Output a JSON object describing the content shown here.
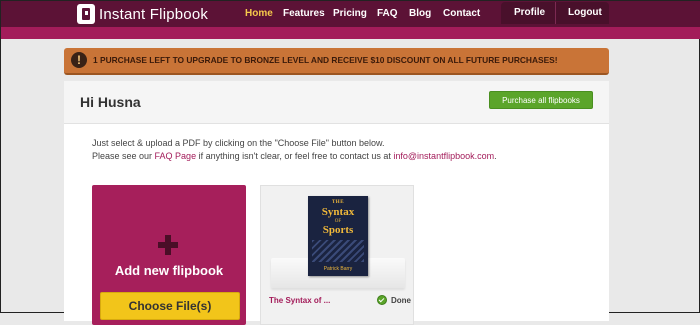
{
  "app": {
    "logo_text": "Instant Flipbook",
    "nav": [
      "Home",
      "Features",
      "Pricing",
      "FAQ",
      "Blog",
      "Contact"
    ],
    "right_nav": [
      "Profile",
      "Logout"
    ],
    "active_tab": "Home",
    "accent_color": "#a31c5a",
    "nav_bg_color": "#5c1236",
    "active_nav_color": "#f6c94b"
  },
  "banner": {
    "icon": "exclamation-icon",
    "text": "1 PURCHASE LEFT TO UPGRADE TO BRONZE LEVEL AND RECEIVE $10 DISCOUNT ON ALL FUTURE PURCHASES!",
    "color": "#c97437"
  },
  "main": {
    "greeting": "Hi Husna",
    "purchase_button": "Purchase all flipbooks",
    "instruction_line1": "Just select & upload a PDF by clicking on the \"Choose File\" button below.",
    "instruction_line2_prefix": "Please see our ",
    "faq_link": "FAQ Page",
    "instruction_line2_middle": " if anything isn't clear, or feel free to contact us at ",
    "email_link": "info@instantflipbook.com",
    "instruction_line2_suffix": "."
  },
  "add_card": {
    "icon": "plus-icon",
    "title": "Add new flipbook",
    "button": "Choose File(s)"
  },
  "book": {
    "cover_the": "THE",
    "cover_syntax": "Syntax",
    "cover_of": "OF",
    "cover_sports": "Sports",
    "cover_author": "Patrick Barry",
    "name": "The Syntax of ...",
    "status": "Done",
    "status_icon": "check-circle-icon"
  }
}
